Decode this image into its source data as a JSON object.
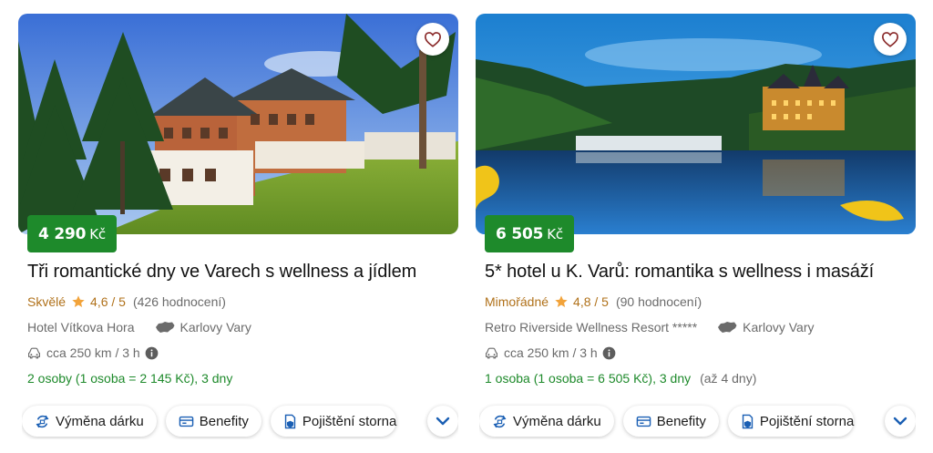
{
  "cards": [
    {
      "price": {
        "amount": "4 290",
        "currency": "Kč"
      },
      "title": "Tři romantické dny ve Varech s wellness a jídlem",
      "rating": {
        "word": "Skvělé",
        "value": "4,6 / 5",
        "count": "(426 hodnocení)"
      },
      "hotel": "Hotel Vítkova Hora",
      "region": "Karlovy Vary",
      "distance": "cca 250 km / 3 h",
      "persons": "2 osoby (1 osoba = 2 145 Kč), 3 dny",
      "persons_extra": "",
      "chips": [
        "Výměna dárku",
        "Benefity",
        "Pojištění storna"
      ],
      "favorite_icon": "heart-icon"
    },
    {
      "price": {
        "amount": "6 505",
        "currency": "Kč"
      },
      "title": "5* hotel u K. Varů: romantika s wellness i masáží",
      "rating": {
        "word": "Mimořádné",
        "value": "4,8 / 5",
        "count": "(90 hodnocení)"
      },
      "hotel": "Retro Riverside Wellness Resort *****",
      "region": "Karlovy Vary",
      "distance": "cca 250 km / 3 h",
      "persons": "1 osoba (1 osoba = 6 505 Kč), 3 dny",
      "persons_extra": "(až 4 dny)",
      "chips": [
        "Výměna dárku",
        "Benefity",
        "Pojištění storna"
      ],
      "favorite_icon": "heart-icon"
    }
  ],
  "colors": {
    "price_badge": "#1e8a2b",
    "rating": "#b0711a",
    "star": "#f2a33a",
    "persons": "#1e8a2b",
    "chevron": "#1a5fb4"
  }
}
